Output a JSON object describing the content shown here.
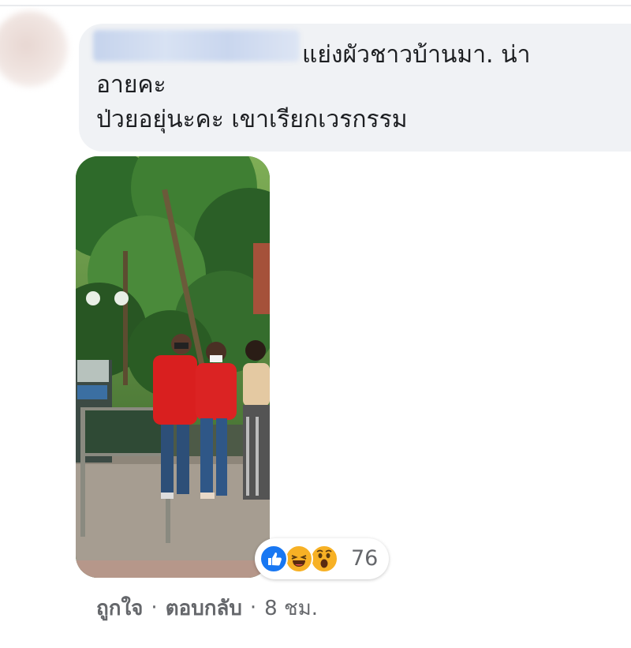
{
  "comment": {
    "author_name": "",
    "lines": [
      "แย่งผัวชาวบ้านมา. น่า",
      "อายคะ",
      "ป่วยอยุ่นะคะ เขาเรียกเวรกรรม"
    ]
  },
  "attachment": {
    "type": "photo",
    "description_icon": "photo"
  },
  "reactions": {
    "icons": [
      "like-icon",
      "haha-icon",
      "wow-icon"
    ],
    "count": "76",
    "colors": {
      "like": "#1877f2",
      "emoji": "#f7b125"
    }
  },
  "actions": {
    "like_label": "ถูกใจ",
    "reply_label": "ตอบกลับ",
    "separator": "·",
    "timestamp": "8 ชม."
  },
  "colors": {
    "bubble_bg": "#f0f2f5",
    "text": "#1c1e21",
    "secondary_text": "#65676b"
  }
}
